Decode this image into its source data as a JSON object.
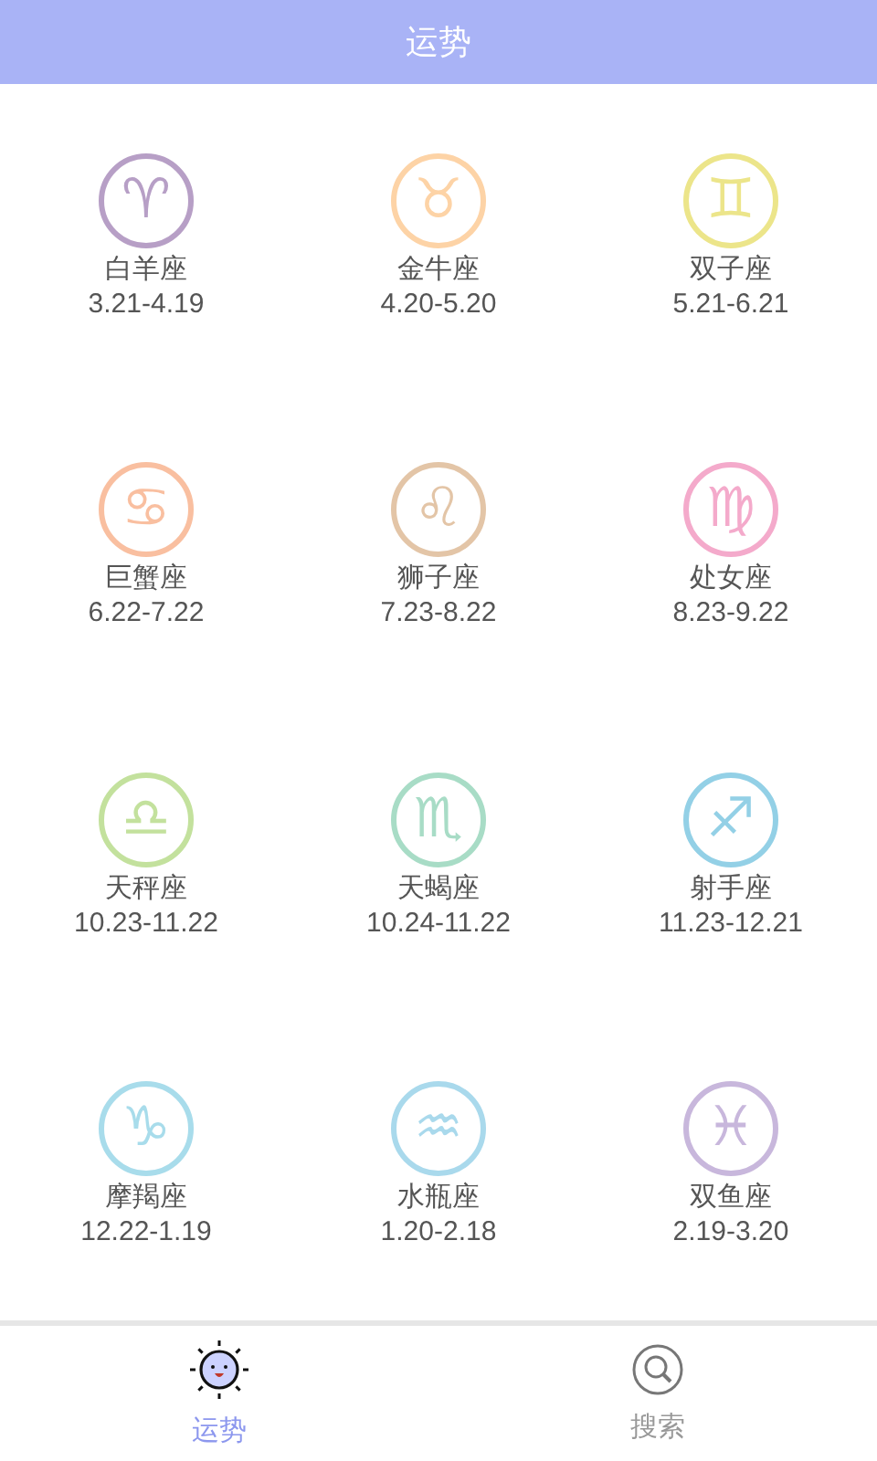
{
  "header": {
    "title": "运势"
  },
  "signs": [
    {
      "symbol": "♈",
      "name": "白羊座",
      "dates": "3.21-4.19",
      "color": "#b79fc6"
    },
    {
      "symbol": "♉",
      "name": "金牛座",
      "dates": "4.20-5.20",
      "color": "#fdd3a6"
    },
    {
      "symbol": "♊",
      "name": "双子座",
      "dates": "5.21-6.21",
      "color": "#ece58a"
    },
    {
      "symbol": "♋",
      "name": "巨蟹座",
      "dates": "6.22-7.22",
      "color": "#f9bfa0"
    },
    {
      "symbol": "♌",
      "name": "狮子座",
      "dates": "7.23-8.22",
      "color": "#e3c5a7"
    },
    {
      "symbol": "♍",
      "name": "处女座",
      "dates": "8.23-9.22",
      "color": "#f4aacb"
    },
    {
      "symbol": "♎",
      "name": "天秤座",
      "dates": "10.23-11.22",
      "color": "#c3e19d"
    },
    {
      "symbol": "♏",
      "name": "天蝎座",
      "dates": "10.24-11.22",
      "color": "#a8dcc6"
    },
    {
      "symbol": "♐",
      "name": "射手座",
      "dates": "11.23-12.21",
      "color": "#93d0e6"
    },
    {
      "symbol": "♑",
      "name": "摩羯座",
      "dates": "12.22-1.19",
      "color": "#a8dceb"
    },
    {
      "symbol": "♒",
      "name": "水瓶座",
      "dates": "1.20-2.18",
      "color": "#a9d9ec"
    },
    {
      "symbol": "♓",
      "name": "双鱼座",
      "dates": "2.19-3.20",
      "color": "#c8b7dc"
    }
  ],
  "tabs": [
    {
      "kind": "sun",
      "label": "运势",
      "selected": true
    },
    {
      "kind": "search",
      "label": "搜索",
      "selected": false
    }
  ]
}
